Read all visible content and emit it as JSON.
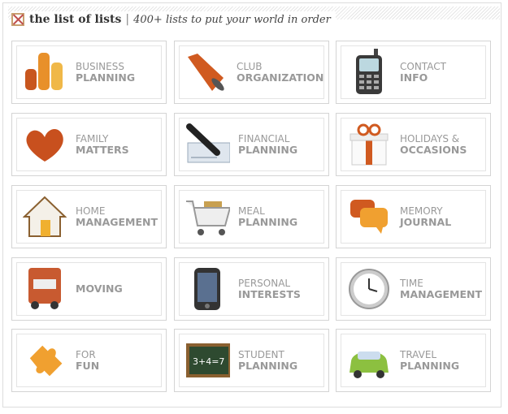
{
  "header": {
    "title": "the list of lists",
    "separator": "|",
    "tagline": "400+ lists to put your world in order"
  },
  "categories": [
    {
      "line1": "BUSINESS",
      "line2": "PLANNING",
      "icon": "bar-chart-icon"
    },
    {
      "line1": "CLUB",
      "line2": "ORGANIZATION",
      "icon": "megaphone-icon"
    },
    {
      "line1": "CONTACT",
      "line2": "INFO",
      "icon": "phone-icon"
    },
    {
      "line1": "FAMILY",
      "line2": "MATTERS",
      "icon": "heart-icon"
    },
    {
      "line1": "FINANCIAL",
      "line2": "PLANNING",
      "icon": "check-pen-icon"
    },
    {
      "line1": "HOLIDAYS &",
      "line2": "OCCASIONS",
      "icon": "gift-icon"
    },
    {
      "line1": "HOME",
      "line2": "MANAGEMENT",
      "icon": "house-icon"
    },
    {
      "line1": "MEAL",
      "line2": "PLANNING",
      "icon": "shopping-cart-icon"
    },
    {
      "line1": "MEMORY",
      "line2": "JOURNAL",
      "icon": "speech-bubbles-icon"
    },
    {
      "line1": "",
      "line2": "MOVING",
      "icon": "truck-icon"
    },
    {
      "line1": "PERSONAL",
      "line2": "INTERESTS",
      "icon": "smartphone-icon"
    },
    {
      "line1": "TIME",
      "line2": "MANAGEMENT",
      "icon": "clock-icon"
    },
    {
      "line1": "FOR",
      "line2": "FUN",
      "icon": "puzzle-icon"
    },
    {
      "line1": "STUDENT",
      "line2": "PLANNING",
      "icon": "chalkboard-icon"
    },
    {
      "line1": "TRAVEL",
      "line2": "PLANNING",
      "icon": "car-icon"
    }
  ],
  "chalkboard_text": "3+4=7"
}
